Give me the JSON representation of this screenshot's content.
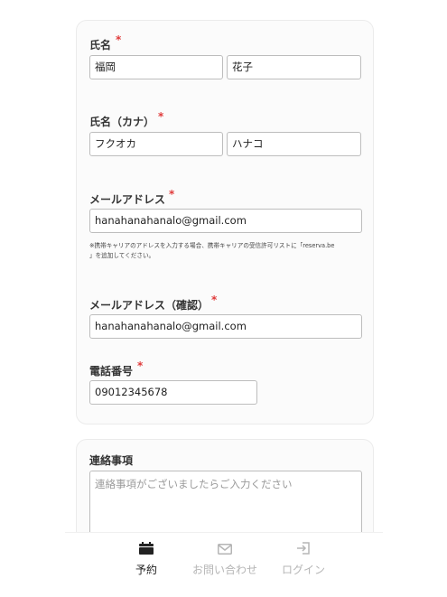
{
  "form": {
    "name": {
      "label": "氏名",
      "required_mark": "*",
      "last": "福岡",
      "first": "花子"
    },
    "kana": {
      "label": "氏名（カナ）",
      "required_mark": "*",
      "last": "フクオカ",
      "first": "ハナコ"
    },
    "email": {
      "label": "メールアドレス",
      "required_mark": "*",
      "value": "hanahanahanalo@gmail.com",
      "note_line1": "※携帯キャリアのアドレスを入力する場合、携帯キャリアの受信許可リストに「reserva.be",
      "note_line2": "」を追加してください。"
    },
    "email_confirm": {
      "label": "メールアドレス（確認）",
      "required_mark": "*",
      "value": "hanahanahanalo@gmail.com"
    },
    "phone": {
      "label": "電話番号",
      "required_mark": "*",
      "value": "09012345678"
    }
  },
  "notes": {
    "label": "連絡事項",
    "placeholder": "連絡事項がございましたらご入力ください"
  },
  "bottom_nav": {
    "items": [
      {
        "label": "予約",
        "icon": "calendar-icon",
        "active": true
      },
      {
        "label": "お問い合わせ",
        "icon": "mail-icon",
        "active": false
      },
      {
        "label": "ログイン",
        "icon": "login-icon",
        "active": false
      }
    ]
  },
  "colors": {
    "required": "#e03a3a",
    "active_nav": "#222222",
    "inactive_nav": "#b5b5b5",
    "placeholder": "#9a9a9a"
  }
}
